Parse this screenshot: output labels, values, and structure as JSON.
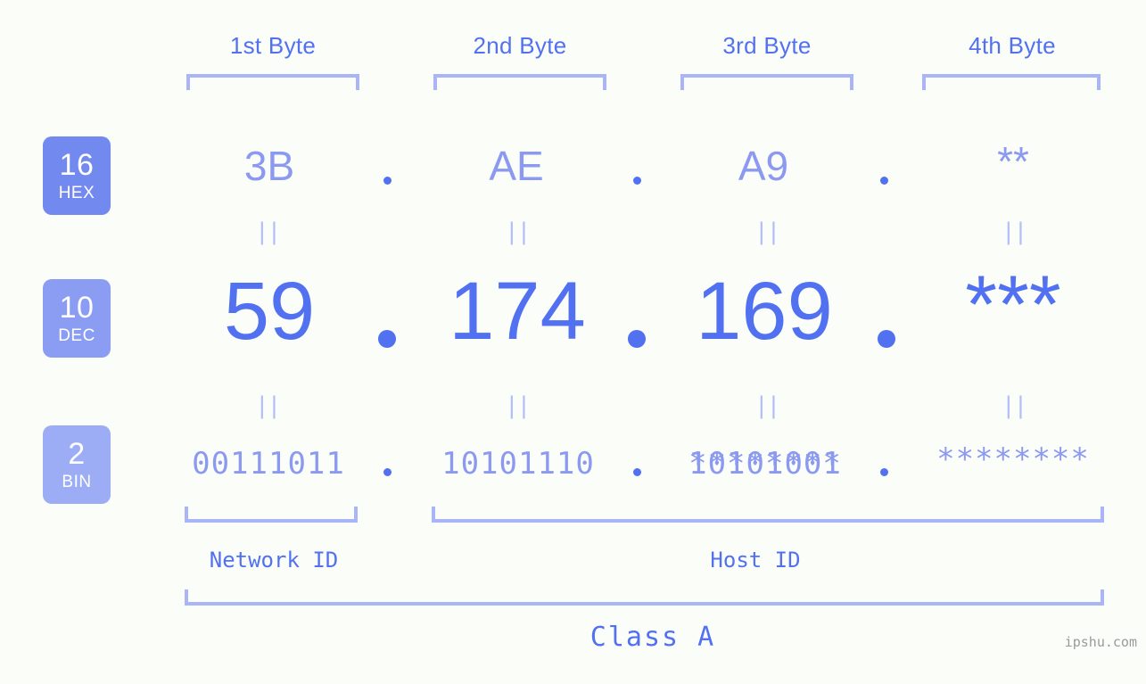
{
  "page": {
    "background_color": "#fbfdf9",
    "accent_color": "#5271f0",
    "muted_accent_color": "#8b9af0",
    "bracket_color": "#aab5f7"
  },
  "byte_headers": [
    {
      "label": "1st Byte"
    },
    {
      "label": "2nd Byte"
    },
    {
      "label": "3rd Byte"
    },
    {
      "label": "4th Byte"
    }
  ],
  "bases": [
    {
      "number": "16",
      "name": "HEX",
      "color": "#7289ef"
    },
    {
      "number": "10",
      "name": "DEC",
      "color": "#8b9df2"
    },
    {
      "number": "2",
      "name": "BIN",
      "color": "#9cadf5"
    }
  ],
  "rows": {
    "hex": {
      "values": [
        "3B",
        "AE",
        "A9",
        "**"
      ]
    },
    "dec": {
      "values": [
        "59",
        "174",
        "169",
        "***"
      ]
    },
    "bin": {
      "values": [
        "00111011",
        "10101110",
        "10101001",
        "********"
      ]
    }
  },
  "equivalence_mark": "||",
  "separator": ".",
  "segments": {
    "network_id": "Network ID",
    "host_id": "Host ID",
    "class": "Class A"
  },
  "watermark": "ipshu.com"
}
